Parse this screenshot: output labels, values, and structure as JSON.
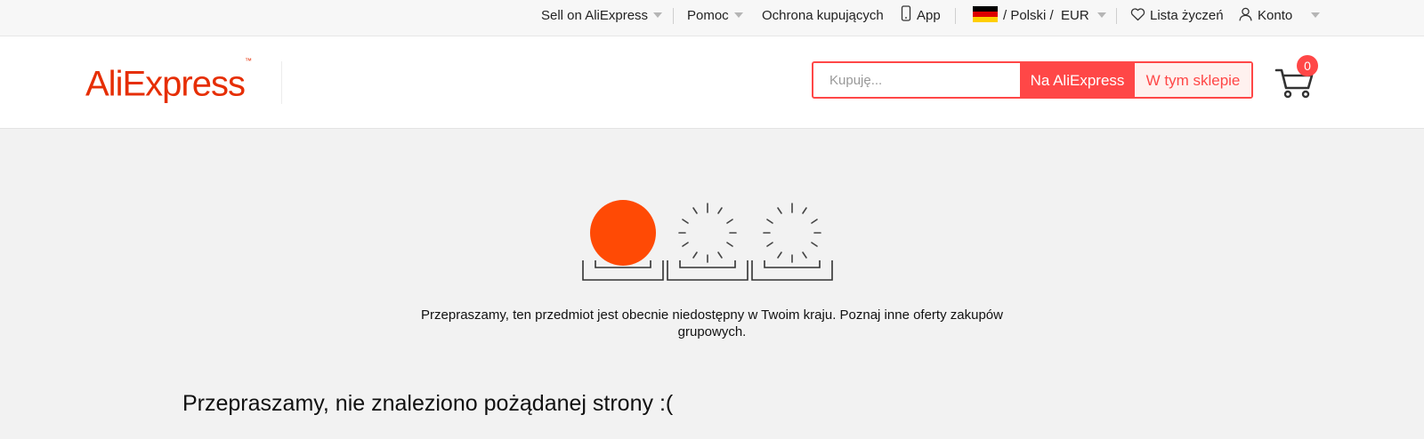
{
  "topbar": {
    "sell": "Sell on AliExpress",
    "help": "Pomoc",
    "protection": "Ochrona kupujących",
    "app": "App",
    "language": "/ Polski /",
    "currency": "EUR",
    "wishlist": "Lista życzeń",
    "account": "Konto"
  },
  "header": {
    "logo": "AliExpress",
    "logo_tm": "™",
    "search_placeholder": "Kupuję...",
    "search_aliexpress": "Na AliExpress",
    "search_store": "W tym sklepie",
    "cart_count": "0"
  },
  "content": {
    "unavailable_message": "Przepraszamy, ten przedmiot jest obecnie niedostępny w Twoim kraju. Poznaj inne oferty zakupów grupowych.",
    "not_found_title": "Przepraszamy, nie znaleziono pożądanej strony :("
  },
  "colors": {
    "accent": "#ff4747",
    "brand": "#e62e04",
    "dot": "#ff4a05"
  },
  "icons": [
    "caret-down-icon",
    "phone-icon",
    "german-flag-icon",
    "heart-icon",
    "user-icon",
    "cart-icon"
  ]
}
